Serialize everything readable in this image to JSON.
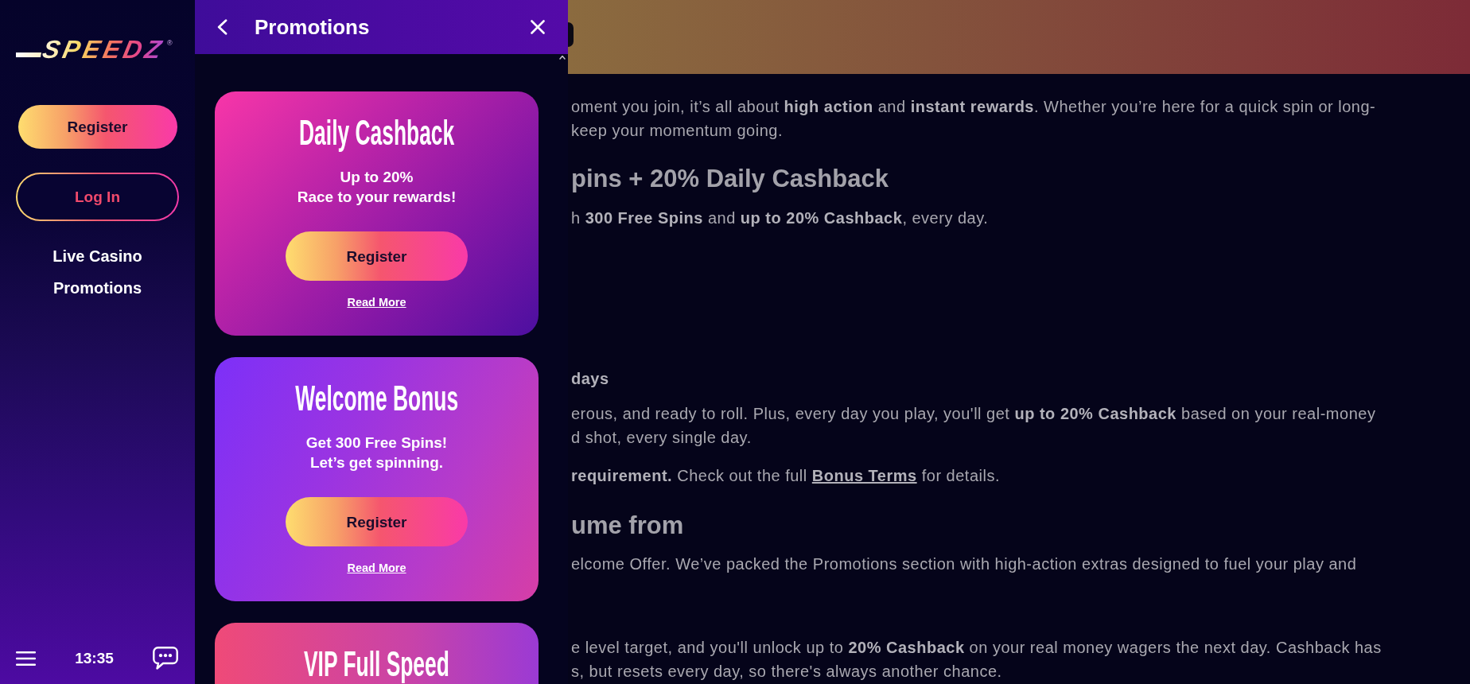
{
  "sidebar": {
    "logo": {
      "wordmark": "SPEEDZ",
      "registered_mark": "®"
    },
    "register_button": "Register",
    "login_button": "Log In",
    "nav_items": [
      {
        "label": "Live Casino"
      },
      {
        "label": "Promotions"
      }
    ],
    "time": "13:35"
  },
  "promotions_panel": {
    "title": "Promotions",
    "cards": [
      {
        "title": "Daily Cashback",
        "description": [
          "Up to 20%",
          "Race to your rewards!"
        ],
        "button": "Register",
        "link": "Read More"
      },
      {
        "title": "Welcome Bonus",
        "description": [
          "Get 300 Free Spins!",
          "Let’s get spinning."
        ],
        "button": "Register",
        "link": "Read More"
      },
      {
        "title": "VIP Full Speed"
      }
    ]
  },
  "content": {
    "blocks": [
      {
        "kind": "paragraph",
        "lines": [
          "oment you join, it’s all about **high action** and **instant rewards**. Whether you’re here for a quick spin or long-",
          "keep your momentum going."
        ]
      },
      {
        "kind": "heading",
        "text": "pins + 20% Daily Cashback"
      },
      {
        "kind": "paragraph",
        "lines": [
          "h **300 Free Spins** and **up to 20% Cashback**, every day."
        ]
      },
      {
        "kind": "subheading",
        "text": "days"
      },
      {
        "kind": "paragraph",
        "lines": [
          "erous, and ready to roll. Plus, every day you play, you'll get **up to 20% Cashback** based on your real-money",
          "d shot, every single day."
        ]
      },
      {
        "kind": "paragraph",
        "lines": [
          "**requirement.** Check out the full "
        ],
        "link": "Bonus Terms",
        "after": " for details."
      },
      {
        "kind": "heading",
        "text": "ume from"
      },
      {
        "kind": "paragraph",
        "lines": [
          "elcome Offer. We’ve packed the Promotions section with high-action extras designed to fuel your play and"
        ]
      },
      {
        "kind": "paragraph",
        "lines": [
          "e level target, and you'll unlock up to **20% Cashback** on your real money wagers the next day. Cashback has",
          "s, but resets every day, so there's always another chance."
        ]
      }
    ]
  }
}
